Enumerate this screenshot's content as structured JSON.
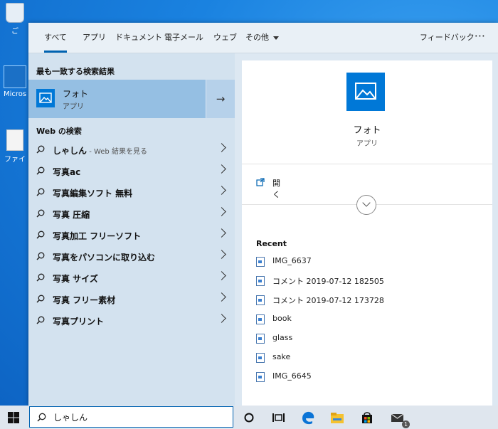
{
  "desktop": {
    "icons": [
      {
        "label": "ご"
      },
      {
        "label": "Micros"
      },
      {
        "label": "ファイ"
      }
    ]
  },
  "tabs": [
    {
      "label": "すべて",
      "active": true
    },
    {
      "label": "アプリ"
    },
    {
      "label": "ドキュメント"
    },
    {
      "label": "電子メール"
    },
    {
      "label": "ウェブ"
    },
    {
      "label": "その他"
    }
  ],
  "feedback_label": "フィードバック",
  "more_label": "···",
  "best_match": {
    "heading": "最も一致する検索結果",
    "title": "フォト",
    "subtitle": "アプリ",
    "arrow": "→"
  },
  "web_search": {
    "heading": "Web の検索",
    "first": {
      "term": "しゃしん",
      "hint": " - Web 結果を見る"
    },
    "items": [
      {
        "term": "写真ac"
      },
      {
        "term": "写真編集ソフト 無料"
      },
      {
        "term": "写真 圧縮"
      },
      {
        "term": "写真加工 フリーソフト"
      },
      {
        "term": "写真をパソコンに取り込む"
      },
      {
        "term": "写真 サイズ"
      },
      {
        "term": "写真 フリー素材"
      },
      {
        "term": "写真プリント"
      }
    ]
  },
  "detail": {
    "title": "フォト",
    "subtitle": "アプリ",
    "open_label": "開く",
    "recent_heading": "Recent",
    "recent": [
      "IMG_6637",
      "コメント 2019-07-12 182505",
      "コメント 2019-07-12 173728",
      "book",
      "glass",
      "sake",
      "IMG_6645"
    ]
  },
  "search": {
    "value": "しゃしん"
  },
  "taskbar": {
    "mail_badge": "1"
  },
  "colors": {
    "accent": "#0078d7",
    "best_match_bg": "#95bfe3",
    "panel_bg": "#d3e2ef"
  }
}
